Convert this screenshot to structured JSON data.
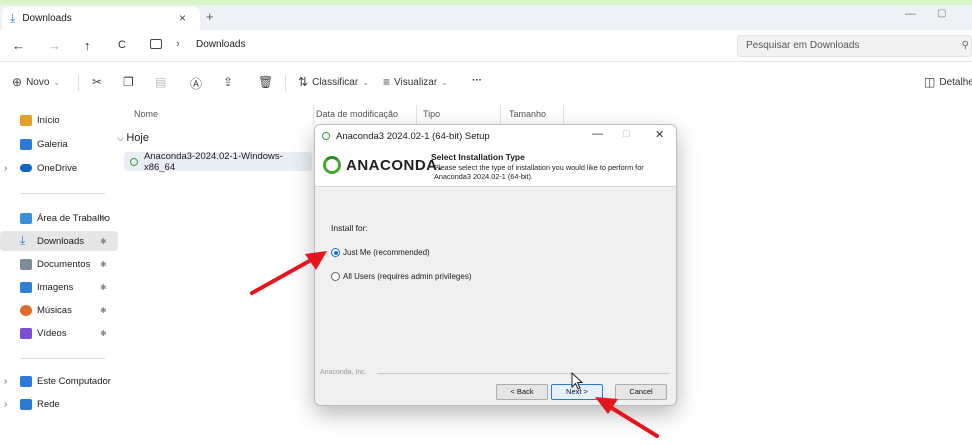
{
  "tab": {
    "label": "Downloads",
    "close": "×",
    "add": "+"
  },
  "window_controls": {
    "minimize": "—",
    "maximize": "▢"
  },
  "nav": {
    "back": "←",
    "forward": "→",
    "up": "↑",
    "refresh": "C"
  },
  "breadcrumb": {
    "separator": "›",
    "current": "Downloads"
  },
  "search": {
    "placeholder": "Pesquisar em Downloads",
    "icon": "search-icon"
  },
  "toolbar": {
    "new_label": "Novo",
    "sort_label": "Classificar",
    "view_label": "Visualizar",
    "more_label": "···",
    "details_label": "Detalhe"
  },
  "sidebar": {
    "items": [
      {
        "label": "Início",
        "icon": "home-icon",
        "color": "#e0a02a"
      },
      {
        "label": "Galeria",
        "icon": "gallery-icon",
        "color": "#2b7bd6"
      },
      {
        "label": "OneDrive",
        "icon": "cloud-icon",
        "color": "#1565c0"
      },
      {
        "label": "Área de Trabalho",
        "icon": "desktop-icon",
        "color": "#3b8ee0"
      },
      {
        "label": "Downloads",
        "icon": "download-icon",
        "color": "#2b7bd6"
      },
      {
        "label": "Documentos",
        "icon": "document-icon",
        "color": "#7d8a99"
      },
      {
        "label": "Imagens",
        "icon": "image-icon",
        "color": "#2f7fd8"
      },
      {
        "label": "Músicas",
        "icon": "music-icon",
        "color": "#e06a2a"
      },
      {
        "label": "Vídeos",
        "icon": "video-icon",
        "color": "#7a4fd0"
      },
      {
        "label": "Este Computador",
        "icon": "computer-icon",
        "color": "#2b7bd6"
      },
      {
        "label": "Rede",
        "icon": "network-icon",
        "color": "#2b7bd6"
      }
    ]
  },
  "filelist": {
    "columns": [
      "Nome",
      "Data de modificação",
      "Tipo",
      "Tamanho"
    ],
    "group": "Hoje",
    "files": [
      {
        "name": "Anaconda3-2024.02-1-Windows-x86_64"
      }
    ]
  },
  "dialog": {
    "title": "Anaconda3 2024.02-1 (64-bit) Setup",
    "logo_text": "ANACONDA.",
    "header_title": "Select Installation Type",
    "header_desc": "Please select the type of installation you would like to perform for Anaconda3 2024.02-1 (64-bit).",
    "install_for": "Install for:",
    "options": [
      {
        "label": "Just Me (recommended)",
        "selected": true
      },
      {
        "label": "All Users (requires admin privileges)",
        "selected": false
      }
    ],
    "vendor": "Anaconda, Inc.",
    "buttons": {
      "back": "< Back",
      "next": "Next >",
      "cancel": "Cancel"
    },
    "controls": {
      "minimize": "—",
      "maximize": "□",
      "close": "✕"
    }
  },
  "colors": {
    "accent": "#2b7bd6",
    "annotation_arrow": "#e3161e",
    "anaconda_green": "#44a833"
  }
}
